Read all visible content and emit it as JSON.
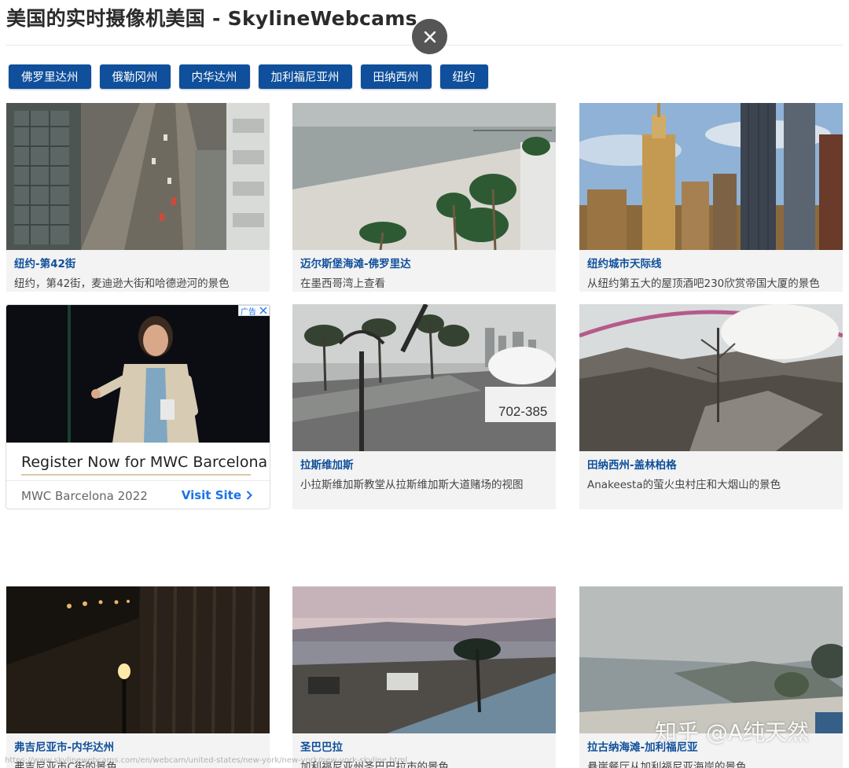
{
  "page": {
    "title": "美国的实时摄像机美国 - SkylineWebcams"
  },
  "state_tabs": [
    {
      "label": "佛罗里达州"
    },
    {
      "label": "俄勒冈州"
    },
    {
      "label": "内华达州"
    },
    {
      "label": "加利福尼亚州"
    },
    {
      "label": "田纳西州"
    },
    {
      "label": "纽约"
    }
  ],
  "cards": [
    {
      "title": "纽约-第42街",
      "desc": "纽约，第42街，麦迪逊大街和哈德逊河的景色"
    },
    {
      "title": "迈尔斯堡海滩-佛罗里达",
      "desc": "在墨西哥湾上查看"
    },
    {
      "title": "纽约城市天际线",
      "desc": "从纽约第五大的屋顶酒吧230欣赏帝国大厦的景色"
    },
    {
      "title": "拉斯维加斯",
      "desc": "小拉斯维加斯教堂从拉斯维加斯大道赌场的视图"
    },
    {
      "title": "田纳西州-盖林柏格",
      "desc": "Anakeesta的萤火虫村庄和大烟山的景色"
    },
    {
      "title": "弗吉尼亚市-内华达州",
      "desc": "弗吉尼亚市C街的景色"
    },
    {
      "title": "圣巴巴拉",
      "desc": "加利福尼亚州圣巴巴拉市的景色"
    },
    {
      "title": "拉古纳海滩-加利福尼亚",
      "desc": "悬崖餐厅从加利福尼亚海岸的景色"
    }
  ],
  "thumb_text": {
    "sign_number": "702-385"
  },
  "ad": {
    "badge_label": "广告",
    "headline": "Register Now for MWC Barcelona",
    "source": "MWC Barcelona 2022",
    "cta": "Visit Site"
  },
  "watermark": "知乎 @A纯天然",
  "status_url": "https://www.skylinewebcams.com/en/webcam/united-states/new-york/new-york/new-york-skyline.html",
  "colors": {
    "tab_blue": "#0f4f9b",
    "caption_bg": "#f3f3f3",
    "ad_link": "#1a73e8"
  },
  "icons": {
    "close": "close-icon",
    "ad_close": "ad-close-icon",
    "cta_chevron": "chevron-right-icon"
  }
}
